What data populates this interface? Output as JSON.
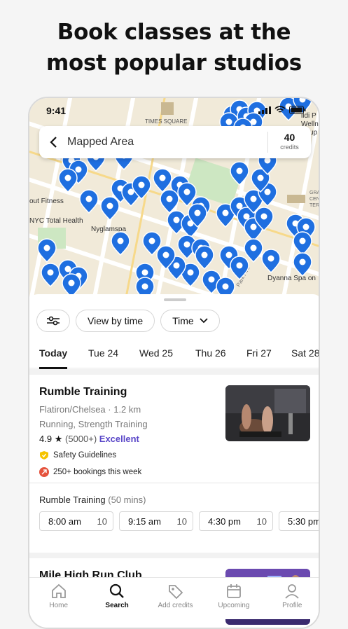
{
  "headline": {
    "line1": "Book classes at the",
    "line2": "most popular studios"
  },
  "status": {
    "time": "9:41"
  },
  "map": {
    "labels": {
      "times_square": "TIMES SQUARE",
      "right_top1": "ildi P",
      "right_top2": "Welln",
      "right_top3": "up",
      "out_fitness": "out Fitness",
      "nyc_total_health": "NYC Total Health",
      "nyglamspa": "Nyglamspa",
      "gra_cen_ter": "GRA\nCEN\nTER",
      "park_ave": "Park Ave",
      "dyanna": "Dyanna Spa on"
    }
  },
  "search": {
    "back_icon": "chevron-left-icon",
    "label": "Mapped Area",
    "credits_value": "40",
    "credits_label": "credits"
  },
  "filters": {
    "filter_icon": "sliders-icon",
    "view_by_time": "View by time",
    "time": "Time"
  },
  "days": [
    {
      "label": "Today",
      "active": true
    },
    {
      "label": "Tue 24"
    },
    {
      "label": "Wed 25"
    },
    {
      "label": "Thu 26"
    },
    {
      "label": "Fri 27"
    },
    {
      "label": "Sat 28"
    }
  ],
  "studios": [
    {
      "name": "Rumble Training",
      "location": "Flatiron/Chelsea · 1.2 km",
      "categories": "Running, Strength Training",
      "rating": "4.9",
      "reviews": "(5000+)",
      "rating_word": "Excellent",
      "safety": "Safety Guidelines",
      "bookings": "250+ bookings this week",
      "session_title": "Rumble Training",
      "session_duration": "(50 mins)",
      "slots": [
        {
          "time": "8:00 am",
          "count": "10"
        },
        {
          "time": "9:15 am",
          "count": "10"
        },
        {
          "time": "4:30 pm",
          "count": "10"
        },
        {
          "time": "5:30 pm",
          "count": ""
        }
      ]
    },
    {
      "name": "Mile High Run Club"
    }
  ],
  "tabs": [
    {
      "label": "Home",
      "icon": "home-icon"
    },
    {
      "label": "Search",
      "icon": "search-icon",
      "active": true
    },
    {
      "label": "Add credits",
      "icon": "tag-icon"
    },
    {
      "label": "Upcoming",
      "icon": "calendar-icon"
    },
    {
      "label": "Profile",
      "icon": "profile-icon"
    }
  ],
  "colors": {
    "accent_purple": "#5a47c8",
    "pin_blue": "#1f6fe0",
    "safety_yellow": "#f5c400",
    "trend_red": "#e5533d"
  }
}
